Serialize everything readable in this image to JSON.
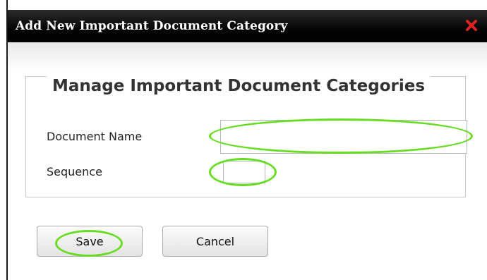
{
  "dialog": {
    "title": "Add New Important Document Category",
    "close_icon": "close-x-icon",
    "title_bar_color": "#000000",
    "close_icon_color": "#dd2222"
  },
  "form": {
    "legend": "Manage Important Document Categories",
    "document_name_label": "Document Name",
    "document_name_value": "",
    "sequence_label": "Sequence",
    "sequence_value": ""
  },
  "buttons": {
    "save_label": "Save",
    "cancel_label": "Cancel"
  },
  "annotations": {
    "highlight_color": "#66dd22"
  }
}
